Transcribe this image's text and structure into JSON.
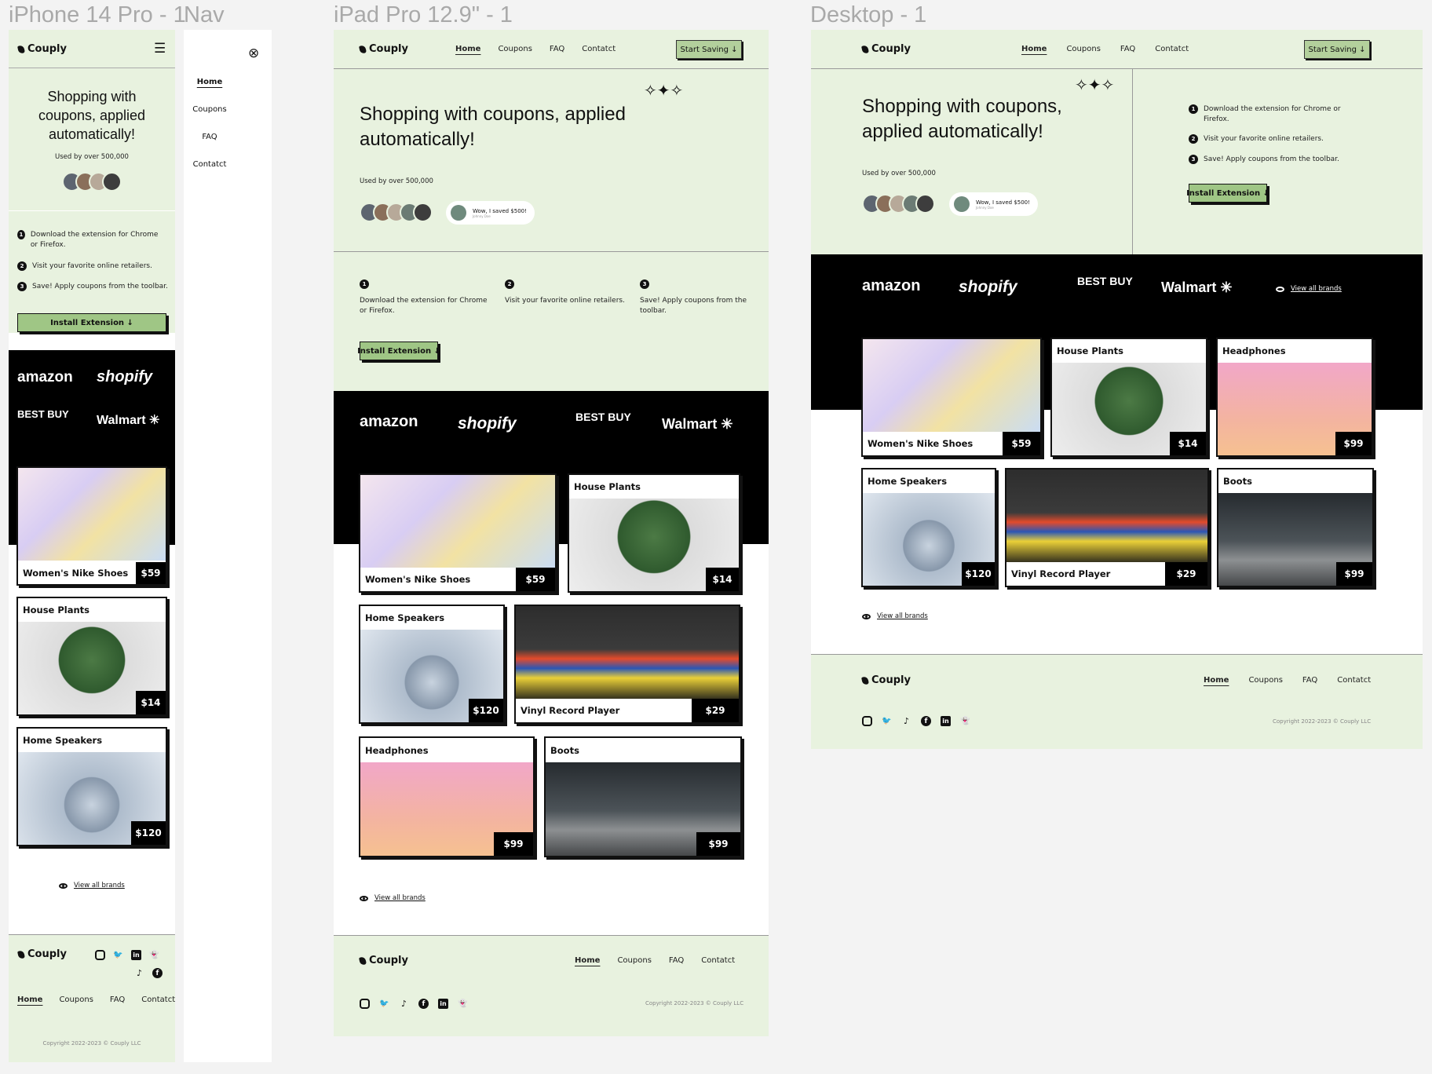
{
  "frames": {
    "iphone": "iPhone 14 Pro - 1",
    "nav": "Nav",
    "ipad": "iPad Pro 12.9\" - 1",
    "desktop": "Desktop - 1"
  },
  "brand": {
    "name": "Couply"
  },
  "nav": {
    "home": "Home",
    "coupons": "Coupons",
    "faq": "FAQ",
    "contact": "Contatct"
  },
  "header": {
    "cta": "Start Saving ↓"
  },
  "hero": {
    "title_mobile": "Shopping with coupons, applied automatically!",
    "title": "Shopping with coupons, applied automatically!",
    "used_by": "Used by over 500,000",
    "testimonial": "Wow, I saved $500!",
    "testimonial_author": "Johnny Doe"
  },
  "steps": [
    {
      "num": "1",
      "text": "Download the extension for Chrome or Firefox."
    },
    {
      "num": "2",
      "text": "Visit your favorite online retailers."
    },
    {
      "num": "3",
      "text": "Save! Apply coupons from the toolbar."
    }
  ],
  "install": "Install Extension ↓",
  "brands": {
    "amazon": "amazon",
    "shopify": "shopify",
    "bestbuy": "BEST BUY",
    "walmart": "Walmart",
    "walmart_spark": "✳",
    "view_all": "View all brands"
  },
  "products": [
    {
      "name": "Women's Nike Shoes",
      "price": "$59"
    },
    {
      "name": "House Plants",
      "price": "$14"
    },
    {
      "name": "Home Speakers",
      "price": "$120"
    },
    {
      "name": "Vinyl Record Player",
      "price": "$29"
    },
    {
      "name": "Headphones",
      "price": "$99"
    },
    {
      "name": "Boots",
      "price": "$99"
    }
  ],
  "footer": {
    "copyright": "Copyright 2022-2023 © Couply LLC"
  },
  "icons": {
    "menu": "☰",
    "close": "⊗",
    "sparkles": "✧✦✧",
    "instagram": "◎",
    "twitter": "🐦",
    "tiktok": "♪",
    "facebook": "f",
    "linkedin": "in",
    "snapchat": "👻"
  },
  "colors": {
    "green_bg": "#e8f2df",
    "accent": "#9fc685",
    "black": "#000000"
  }
}
